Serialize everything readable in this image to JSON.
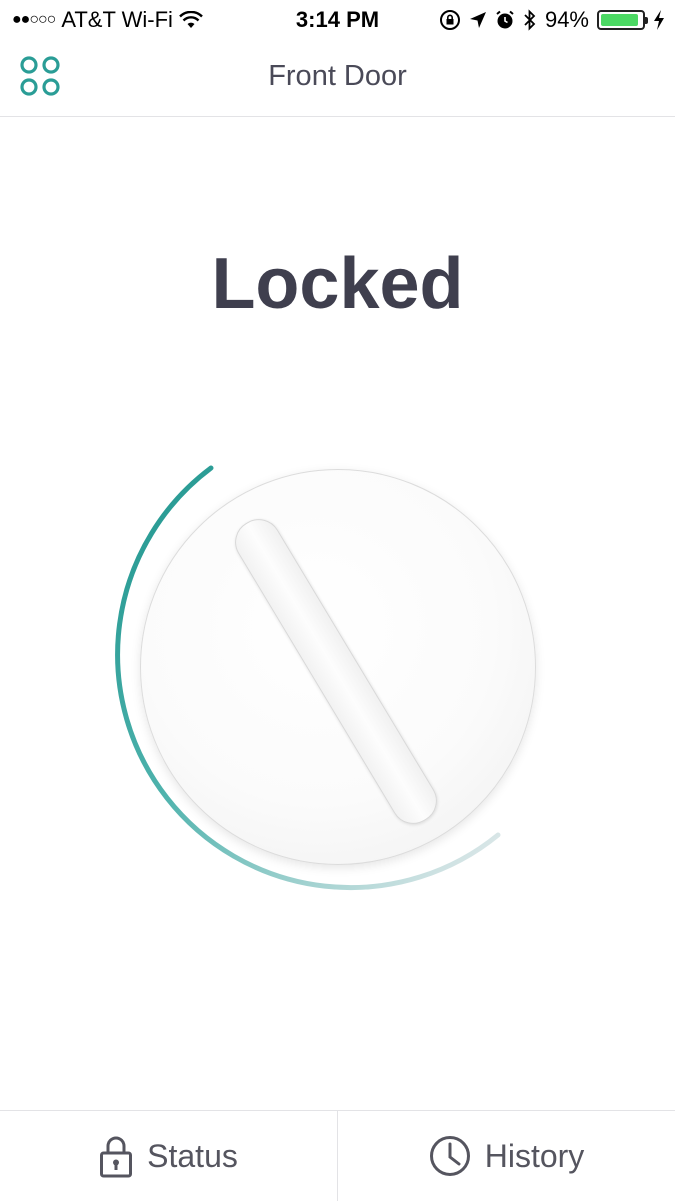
{
  "status_bar": {
    "carrier": "AT&T Wi-Fi",
    "time": "3:14 PM",
    "battery_percent": "94%",
    "battery_level": 0.94,
    "icons": [
      "signal-dots-icon",
      "wifi-icon",
      "rotation-lock-icon",
      "location-arrow-icon",
      "alarm-icon",
      "bluetooth-icon",
      "battery-icon",
      "charging-bolt-icon"
    ]
  },
  "nav": {
    "title": "Front Door",
    "menu_icon": "apps-grid-icon"
  },
  "lock": {
    "status": "Locked"
  },
  "tabs": [
    {
      "label": "Status",
      "icon": "padlock-icon"
    },
    {
      "label": "History",
      "icon": "clock-icon"
    }
  ],
  "colors": {
    "accent": "#2a9d96",
    "title_text": "#3f3f4e",
    "battery_fill": "#4cd964"
  }
}
